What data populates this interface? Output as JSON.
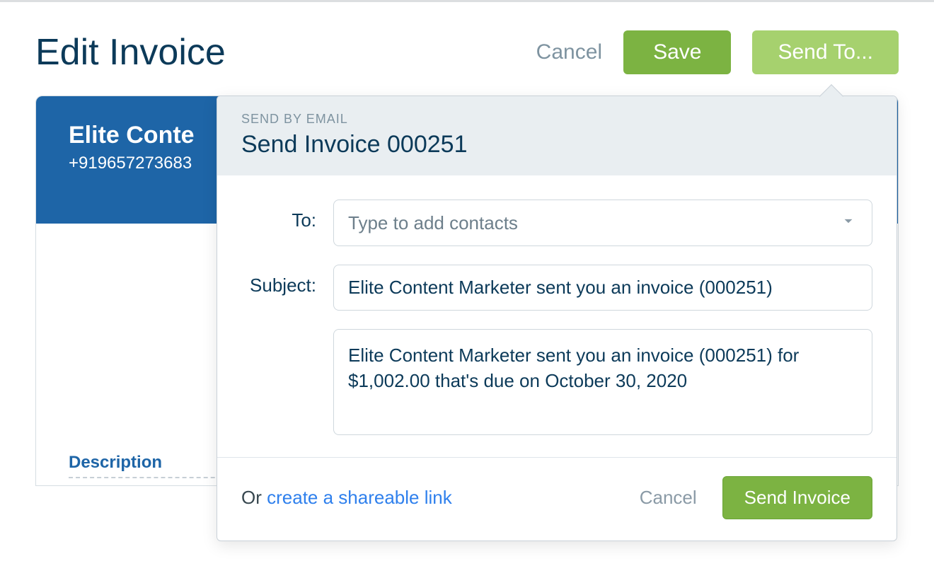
{
  "header": {
    "title": "Edit Invoice",
    "cancel_label": "Cancel",
    "save_label": "Save",
    "send_to_label": "Send To..."
  },
  "invoice_card": {
    "company_name": "Elite Conte",
    "phone": "+919657273683",
    "description_label": "Description"
  },
  "popover": {
    "eyebrow": "SEND BY EMAIL",
    "title": "Send Invoice 000251",
    "to_label": "To:",
    "to_placeholder": "Type to add contacts",
    "subject_label": "Subject:",
    "subject_value": "Elite Content Marketer sent you an invoice (000251)",
    "body_value": "Elite Content Marketer sent you an invoice (000251) for $1,002.00 that's due on October 30, 2020",
    "footer_or": "Or ",
    "footer_link": "create a shareable link",
    "cancel_label": "Cancel",
    "send_label": "Send Invoice"
  }
}
